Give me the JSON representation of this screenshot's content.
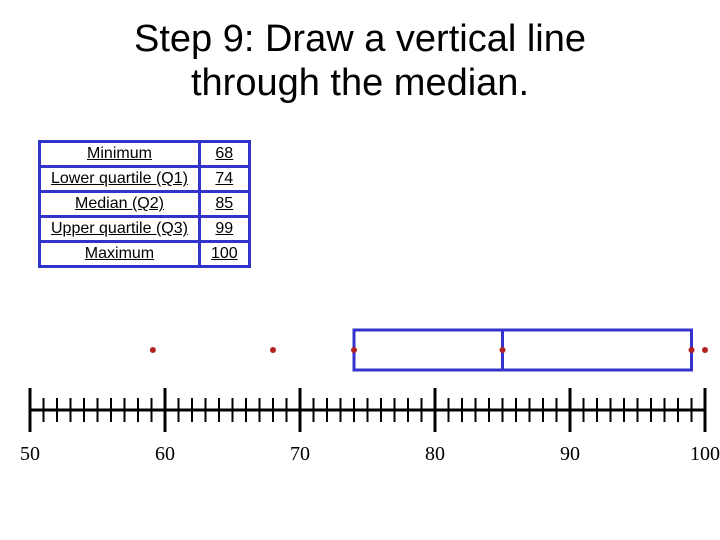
{
  "title_line1": "Step 9:  Draw a vertical line",
  "title_line2": "through the median.",
  "table": {
    "rows": [
      {
        "label": "Minimum",
        "value": "68"
      },
      {
        "label": "Lower quartile (Q1)",
        "value": "74"
      },
      {
        "label": "Median (Q2)",
        "value": "85"
      },
      {
        "label": "Upper quartile (Q3)",
        "value": "99"
      },
      {
        "label": "Maximum",
        "value": "100"
      }
    ]
  },
  "axis": {
    "min": 50,
    "max": 100,
    "major_step": 10,
    "minor_step": 1,
    "labels": [
      "50",
      "60",
      "70",
      "80",
      "90",
      "100"
    ]
  },
  "chart_data": {
    "type": "boxplot",
    "title": "Step 9: Draw a vertical line through the median.",
    "xlabel": "",
    "ylabel": "",
    "xlim": [
      50,
      100
    ],
    "minimum": 68,
    "q1": 74,
    "median": 85,
    "q3": 99,
    "maximum": 100,
    "dots": [
      59.1,
      68,
      74,
      85,
      99,
      100
    ],
    "axis_ticks": [
      50,
      60,
      70,
      80,
      90,
      100
    ]
  },
  "colors": {
    "box_border": "#3333cc",
    "axis": "#000000",
    "dot": "#b22222"
  }
}
